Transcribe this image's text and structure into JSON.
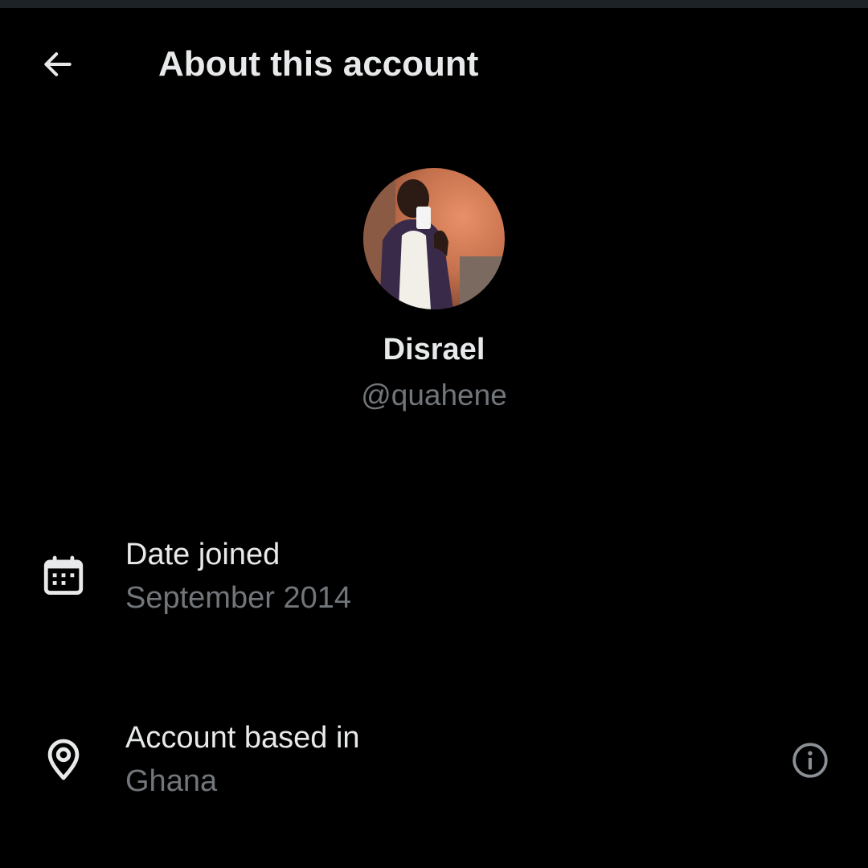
{
  "header": {
    "title": "About this account",
    "back_icon": "arrow-left-icon"
  },
  "profile": {
    "display_name": "Disrael",
    "handle": "@quahene"
  },
  "details": [
    {
      "icon": "calendar-icon",
      "label": "Date joined",
      "value": "September 2014"
    },
    {
      "icon": "location-pin-icon",
      "label": "Account based in",
      "value": "Ghana",
      "info_icon": "info-circle-icon"
    }
  ],
  "colors": {
    "background": "#000000",
    "primary_text": "#e7e9ea",
    "secondary_text": "#71767b",
    "top_strip": "#1d2226"
  }
}
